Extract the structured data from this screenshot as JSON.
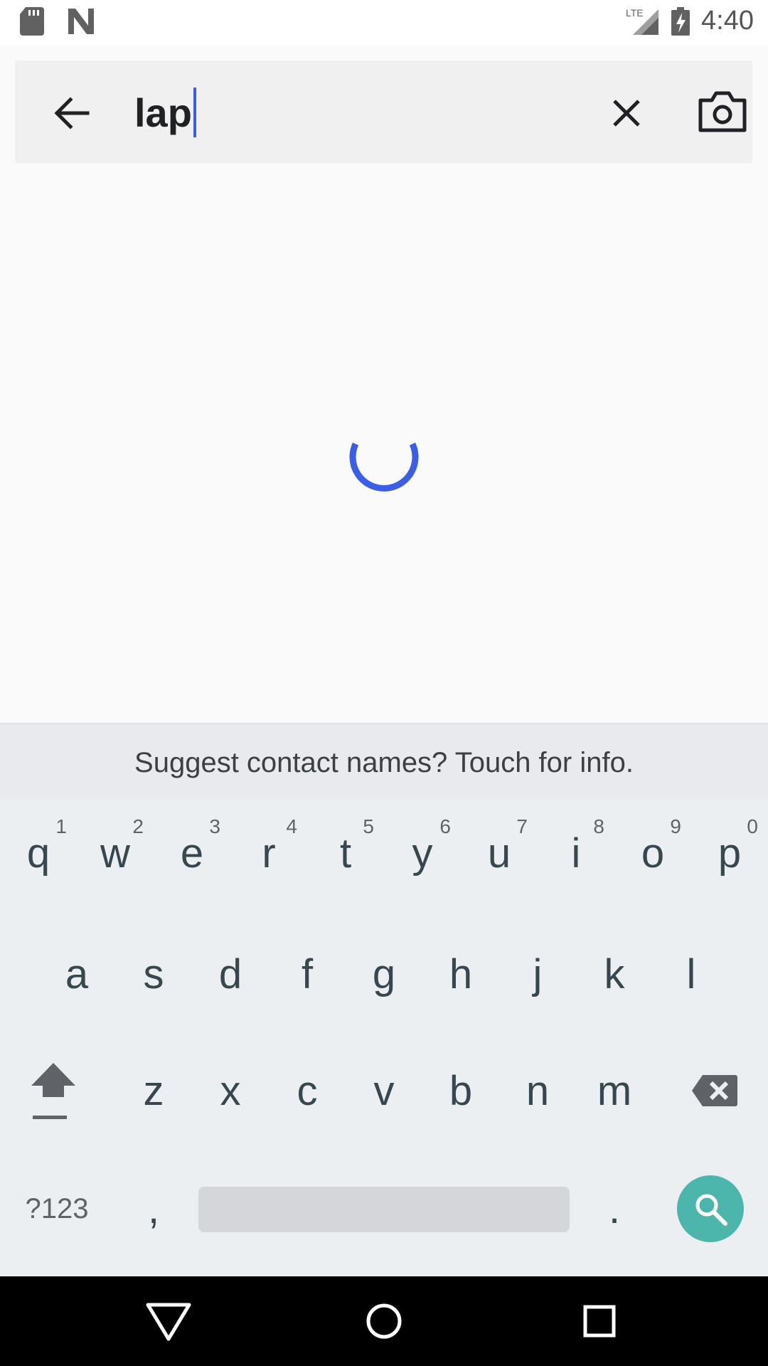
{
  "status_bar": {
    "time": "4:40",
    "network": "LTE",
    "icons": [
      "sd-card-icon",
      "n-logo-icon",
      "signal-icon",
      "battery-charging-icon"
    ]
  },
  "search": {
    "query": "lap",
    "icons": [
      "back-arrow-icon",
      "clear-icon",
      "camera-icon"
    ]
  },
  "loading": {
    "icon": "loading-spinner-icon"
  },
  "keyboard": {
    "suggestion": "Suggest contact names? Touch for info.",
    "row1": [
      {
        "label": "q",
        "hint": "1"
      },
      {
        "label": "w",
        "hint": "2"
      },
      {
        "label": "e",
        "hint": "3"
      },
      {
        "label": "r",
        "hint": "4"
      },
      {
        "label": "t",
        "hint": "5"
      },
      {
        "label": "y",
        "hint": "6"
      },
      {
        "label": "u",
        "hint": "7"
      },
      {
        "label": "i",
        "hint": "8"
      },
      {
        "label": "o",
        "hint": "9"
      },
      {
        "label": "p",
        "hint": "0"
      }
    ],
    "row2": [
      "a",
      "s",
      "d",
      "f",
      "g",
      "h",
      "j",
      "k",
      "l"
    ],
    "row3": [
      "z",
      "x",
      "c",
      "v",
      "b",
      "n",
      "m"
    ],
    "symbols_label": "?123",
    "comma_label": ",",
    "period_label": ".",
    "icons": [
      "shift-icon",
      "backspace-icon",
      "search-icon"
    ]
  },
  "nav_bar": {
    "icons": [
      "back-triangle-icon",
      "home-circle-icon",
      "recents-square-icon"
    ]
  },
  "colors": {
    "accent": "#3b5ee6",
    "search_key": "#4db6ac",
    "keyboard_bg": "#eceff1"
  }
}
